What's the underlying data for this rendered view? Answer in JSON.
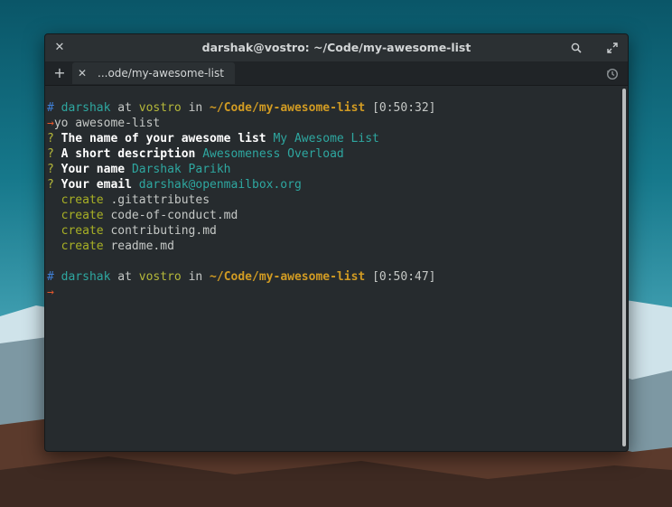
{
  "window": {
    "title": "darshak@vostro: ~/Code/my-awesome-list",
    "tab_label": "...ode/my-awesome-list"
  },
  "terminal": {
    "prompt1": {
      "hash": "#",
      "user": "darshak",
      "at": "at",
      "host": "vostro",
      "in": "in",
      "path": "~/Code/my-awesome-list",
      "time": "[0:50:32]"
    },
    "command": {
      "arrow": "→",
      "text": "yo awesome-list"
    },
    "questions": [
      {
        "mark": "?",
        "question": "The name of your awesome list",
        "answer": "My Awesome List"
      },
      {
        "mark": "?",
        "question": "A short description",
        "answer": "Awesomeness Overload"
      },
      {
        "mark": "?",
        "question": "Your name",
        "answer": "Darshak Parikh"
      },
      {
        "mark": "?",
        "question": "Your email",
        "answer": "darshak@openmailbox.org"
      }
    ],
    "creates": [
      {
        "verb": "create",
        "file": ".gitattributes"
      },
      {
        "verb": "create",
        "file": "code-of-conduct.md"
      },
      {
        "verb": "create",
        "file": "contributing.md"
      },
      {
        "verb": "create",
        "file": "readme.md"
      }
    ],
    "prompt2": {
      "hash": "#",
      "user": "darshak",
      "at": "at",
      "host": "vostro",
      "in": "in",
      "path": "~/Code/my-awesome-list",
      "time": "[0:50:47]"
    },
    "final_arrow": "→"
  },
  "icons": {
    "close": "close-icon",
    "search": "search-icon",
    "maximize": "maximize-icon",
    "new_tab": "plus-icon",
    "tab_close": "close-icon",
    "history": "history-icon"
  }
}
